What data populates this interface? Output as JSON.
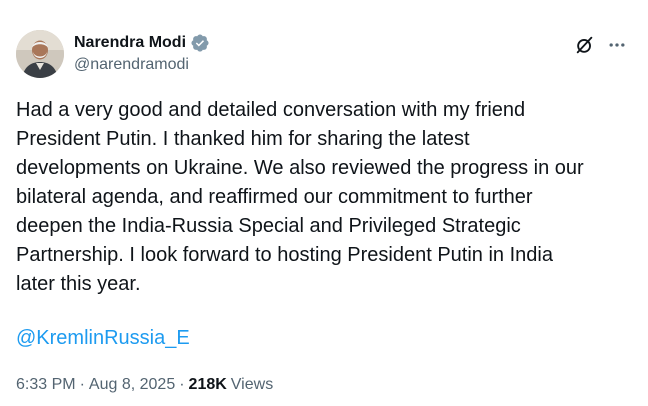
{
  "author": {
    "display_name": "Narendra Modi",
    "handle": "@narendramodi",
    "verified_badge_icon": "verified-badge-icon",
    "verified_color": "#829aab"
  },
  "header_actions": [
    {
      "name": "grok-icon"
    },
    {
      "name": "more-options-icon"
    }
  ],
  "tweet": {
    "text": "Had a very good and detailed conversation with my friend\nPresident Putin. I thanked him for sharing the latest\ndevelopments on Ukraine. We also reviewed the progress in our\nbilateral agenda, and reaffirmed our commitment to further\ndeepen the India-Russia Special and Privileged Strategic\nPartnership. I look forward to hosting President Putin in India\nlater this year.",
    "mention": "@KremlinRussia_E"
  },
  "meta": {
    "time": "6:33 PM",
    "separator": "·",
    "date": "Aug 8, 2025",
    "views_count": "218K",
    "views_label": "Views"
  },
  "colors": {
    "text_primary": "#0f1419",
    "text_secondary": "#536471",
    "link": "#1d9bf0"
  }
}
